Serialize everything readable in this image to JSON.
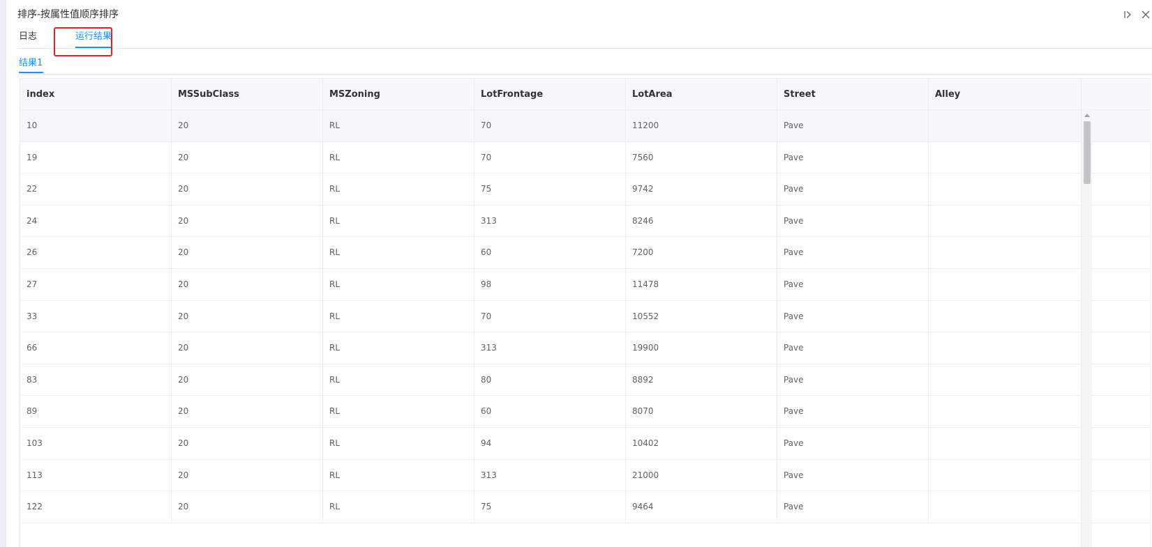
{
  "dialog": {
    "title": "排序-按属性值顺序排序"
  },
  "header_icons": [
    "collapse-right-icon",
    "close-icon"
  ],
  "tabs": [
    {
      "label": "日志",
      "active": false
    },
    {
      "label": "运行结果",
      "active": true
    }
  ],
  "subtabs": [
    {
      "label": "结果1",
      "active": true
    }
  ],
  "colors": {
    "accent": "#1890ff",
    "highlight": "#e02424"
  },
  "table": {
    "columns": [
      "index",
      "MSSubClass",
      "MSZoning",
      "LotFrontage",
      "LotArea",
      "Street",
      "Alley"
    ],
    "rows": [
      [
        "10",
        "20",
        "RL",
        "70",
        "11200",
        "Pave",
        ""
      ],
      [
        "19",
        "20",
        "RL",
        "70",
        "7560",
        "Pave",
        ""
      ],
      [
        "22",
        "20",
        "RL",
        "75",
        "9742",
        "Pave",
        ""
      ],
      [
        "24",
        "20",
        "RL",
        "313",
        "8246",
        "Pave",
        ""
      ],
      [
        "26",
        "20",
        "RL",
        "60",
        "7200",
        "Pave",
        ""
      ],
      [
        "27",
        "20",
        "RL",
        "98",
        "11478",
        "Pave",
        ""
      ],
      [
        "33",
        "20",
        "RL",
        "70",
        "10552",
        "Pave",
        ""
      ],
      [
        "66",
        "20",
        "RL",
        "313",
        "19900",
        "Pave",
        ""
      ],
      [
        "83",
        "20",
        "RL",
        "80",
        "8892",
        "Pave",
        ""
      ],
      [
        "89",
        "20",
        "RL",
        "60",
        "8070",
        "Pave",
        ""
      ],
      [
        "103",
        "20",
        "RL",
        "94",
        "10402",
        "Pave",
        ""
      ],
      [
        "113",
        "20",
        "RL",
        "313",
        "21000",
        "Pave",
        ""
      ],
      [
        "122",
        "20",
        "RL",
        "75",
        "9464",
        "Pave",
        ""
      ]
    ]
  }
}
